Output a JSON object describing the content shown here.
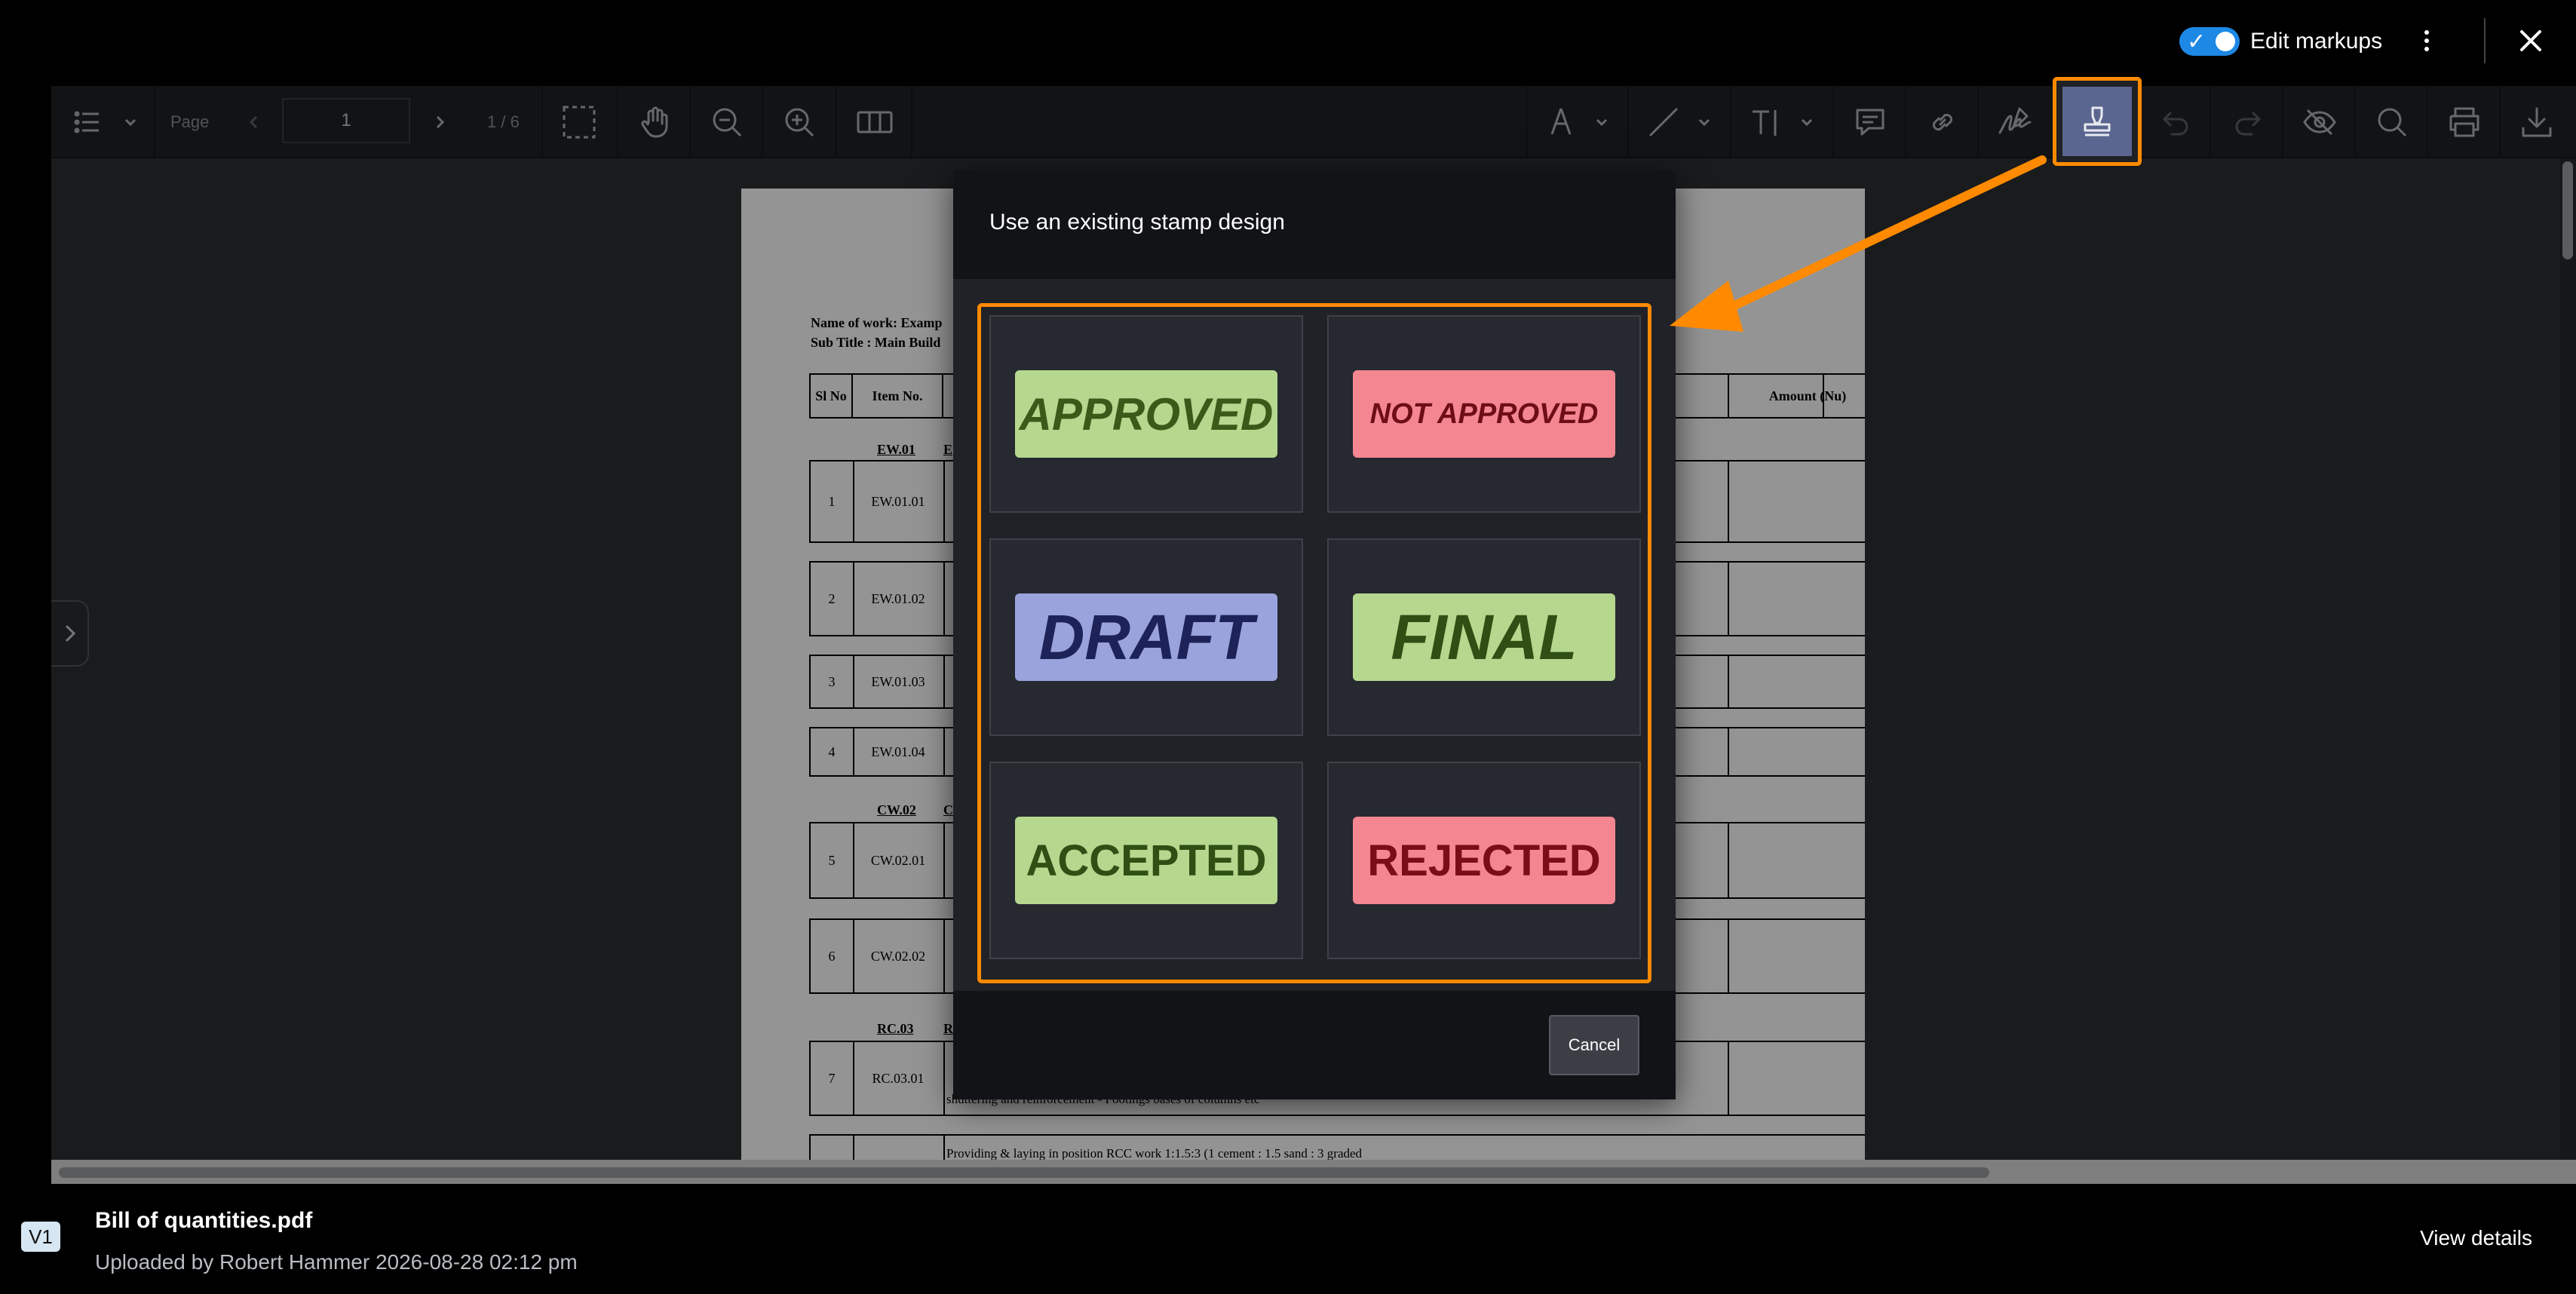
{
  "topbar": {
    "edit_markups_label": "Edit markups",
    "edit_markups_on": true
  },
  "toolbar": {
    "page_label": "Page",
    "current_page": "1",
    "page_count": "1 / 6",
    "tools": [
      "outline-list-icon",
      "selection-icon",
      "pan-icon",
      "zoom-out-icon",
      "zoom-in-icon",
      "split-view-icon",
      "pen-icon",
      "line-icon",
      "text-icon",
      "comment-icon",
      "link-icon",
      "signature-icon",
      "stamp-icon",
      "undo-icon",
      "redo-icon",
      "hide-markups-icon",
      "search-icon",
      "print-icon",
      "download-icon"
    ],
    "active_tool": "stamp-icon"
  },
  "document": {
    "name_of_work": "Name of work: Examp",
    "sub_title": "Sub Title : Main Build",
    "headers": {
      "sl_no": "Sl No",
      "item_no": "Item No.",
      "amount": "Amount (Nu)"
    },
    "sections": [
      {
        "code": "EW.01",
        "letter": "E"
      },
      {
        "code": "CW.02",
        "letter": "C"
      },
      {
        "code": "RC.03",
        "letter": "R"
      }
    ],
    "rows": [
      {
        "sl": "1",
        "item": "EW.01.01"
      },
      {
        "sl": "2",
        "item": "EW.01.02"
      },
      {
        "sl": "3",
        "item": "EW.01.03"
      },
      {
        "sl": "4",
        "item": "EW.01.04"
      },
      {
        "sl": "5",
        "item": "CW.02.01"
      },
      {
        "sl": "6",
        "item": "CW.02.02"
      },
      {
        "sl": "7",
        "item": "RC.03.01"
      }
    ],
    "last_row_text": "Providing & laying in position RCC work 1:1.5:3 (1 cement : 1.5 sand : 3 graded",
    "row7_text": "shuttering and reinforcement - Footings bases of columns etc"
  },
  "stamp_dialog": {
    "title": "Use an existing stamp design",
    "cancel_label": "Cancel",
    "stamps": [
      {
        "label": "APPROVED",
        "bg": "#b5d88e",
        "fg": "#3a5a1a",
        "italic": true
      },
      {
        "label": "NOT APPROVED",
        "bg": "#f38690",
        "fg": "#6e0d16",
        "italic": true
      },
      {
        "label": "DRAFT",
        "bg": "#9aa3dc",
        "fg": "#1d2358",
        "italic": true
      },
      {
        "label": "FINAL",
        "bg": "#b5d88e",
        "fg": "#2f4f14",
        "italic": true
      },
      {
        "label": "ACCEPTED",
        "bg": "#b5d88e",
        "fg": "#2f4f14",
        "italic": false
      },
      {
        "label": "REJECTED",
        "bg": "#f38690",
        "fg": "#7a0d18",
        "italic": false
      }
    ]
  },
  "bottombar": {
    "version": "V1",
    "file_name": "Bill of quantities.pdf",
    "uploaded_by": "Uploaded by Robert Hammer  2026-08-28 02:12 pm",
    "view_details": "View details"
  },
  "colors": {
    "accent_orange": "#ff8a00",
    "toggle_blue": "#1e88e5"
  }
}
